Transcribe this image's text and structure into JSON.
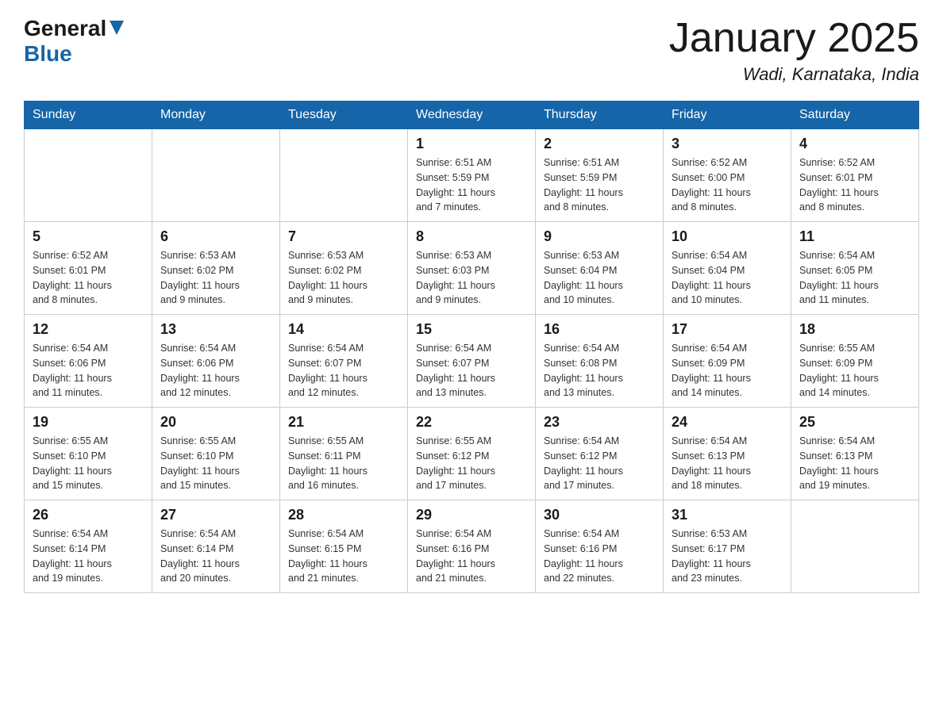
{
  "header": {
    "logo_general": "General",
    "logo_blue": "Blue",
    "month_title": "January 2025",
    "location": "Wadi, Karnataka, India"
  },
  "weekdays": [
    "Sunday",
    "Monday",
    "Tuesday",
    "Wednesday",
    "Thursday",
    "Friday",
    "Saturday"
  ],
  "weeks": [
    [
      {
        "day": "",
        "info": ""
      },
      {
        "day": "",
        "info": ""
      },
      {
        "day": "",
        "info": ""
      },
      {
        "day": "1",
        "info": "Sunrise: 6:51 AM\nSunset: 5:59 PM\nDaylight: 11 hours\nand 7 minutes."
      },
      {
        "day": "2",
        "info": "Sunrise: 6:51 AM\nSunset: 5:59 PM\nDaylight: 11 hours\nand 8 minutes."
      },
      {
        "day": "3",
        "info": "Sunrise: 6:52 AM\nSunset: 6:00 PM\nDaylight: 11 hours\nand 8 minutes."
      },
      {
        "day": "4",
        "info": "Sunrise: 6:52 AM\nSunset: 6:01 PM\nDaylight: 11 hours\nand 8 minutes."
      }
    ],
    [
      {
        "day": "5",
        "info": "Sunrise: 6:52 AM\nSunset: 6:01 PM\nDaylight: 11 hours\nand 8 minutes."
      },
      {
        "day": "6",
        "info": "Sunrise: 6:53 AM\nSunset: 6:02 PM\nDaylight: 11 hours\nand 9 minutes."
      },
      {
        "day": "7",
        "info": "Sunrise: 6:53 AM\nSunset: 6:02 PM\nDaylight: 11 hours\nand 9 minutes."
      },
      {
        "day": "8",
        "info": "Sunrise: 6:53 AM\nSunset: 6:03 PM\nDaylight: 11 hours\nand 9 minutes."
      },
      {
        "day": "9",
        "info": "Sunrise: 6:53 AM\nSunset: 6:04 PM\nDaylight: 11 hours\nand 10 minutes."
      },
      {
        "day": "10",
        "info": "Sunrise: 6:54 AM\nSunset: 6:04 PM\nDaylight: 11 hours\nand 10 minutes."
      },
      {
        "day": "11",
        "info": "Sunrise: 6:54 AM\nSunset: 6:05 PM\nDaylight: 11 hours\nand 11 minutes."
      }
    ],
    [
      {
        "day": "12",
        "info": "Sunrise: 6:54 AM\nSunset: 6:06 PM\nDaylight: 11 hours\nand 11 minutes."
      },
      {
        "day": "13",
        "info": "Sunrise: 6:54 AM\nSunset: 6:06 PM\nDaylight: 11 hours\nand 12 minutes."
      },
      {
        "day": "14",
        "info": "Sunrise: 6:54 AM\nSunset: 6:07 PM\nDaylight: 11 hours\nand 12 minutes."
      },
      {
        "day": "15",
        "info": "Sunrise: 6:54 AM\nSunset: 6:07 PM\nDaylight: 11 hours\nand 13 minutes."
      },
      {
        "day": "16",
        "info": "Sunrise: 6:54 AM\nSunset: 6:08 PM\nDaylight: 11 hours\nand 13 minutes."
      },
      {
        "day": "17",
        "info": "Sunrise: 6:54 AM\nSunset: 6:09 PM\nDaylight: 11 hours\nand 14 minutes."
      },
      {
        "day": "18",
        "info": "Sunrise: 6:55 AM\nSunset: 6:09 PM\nDaylight: 11 hours\nand 14 minutes."
      }
    ],
    [
      {
        "day": "19",
        "info": "Sunrise: 6:55 AM\nSunset: 6:10 PM\nDaylight: 11 hours\nand 15 minutes."
      },
      {
        "day": "20",
        "info": "Sunrise: 6:55 AM\nSunset: 6:10 PM\nDaylight: 11 hours\nand 15 minutes."
      },
      {
        "day": "21",
        "info": "Sunrise: 6:55 AM\nSunset: 6:11 PM\nDaylight: 11 hours\nand 16 minutes."
      },
      {
        "day": "22",
        "info": "Sunrise: 6:55 AM\nSunset: 6:12 PM\nDaylight: 11 hours\nand 17 minutes."
      },
      {
        "day": "23",
        "info": "Sunrise: 6:54 AM\nSunset: 6:12 PM\nDaylight: 11 hours\nand 17 minutes."
      },
      {
        "day": "24",
        "info": "Sunrise: 6:54 AM\nSunset: 6:13 PM\nDaylight: 11 hours\nand 18 minutes."
      },
      {
        "day": "25",
        "info": "Sunrise: 6:54 AM\nSunset: 6:13 PM\nDaylight: 11 hours\nand 19 minutes."
      }
    ],
    [
      {
        "day": "26",
        "info": "Sunrise: 6:54 AM\nSunset: 6:14 PM\nDaylight: 11 hours\nand 19 minutes."
      },
      {
        "day": "27",
        "info": "Sunrise: 6:54 AM\nSunset: 6:14 PM\nDaylight: 11 hours\nand 20 minutes."
      },
      {
        "day": "28",
        "info": "Sunrise: 6:54 AM\nSunset: 6:15 PM\nDaylight: 11 hours\nand 21 minutes."
      },
      {
        "day": "29",
        "info": "Sunrise: 6:54 AM\nSunset: 6:16 PM\nDaylight: 11 hours\nand 21 minutes."
      },
      {
        "day": "30",
        "info": "Sunrise: 6:54 AM\nSunset: 6:16 PM\nDaylight: 11 hours\nand 22 minutes."
      },
      {
        "day": "31",
        "info": "Sunrise: 6:53 AM\nSunset: 6:17 PM\nDaylight: 11 hours\nand 23 minutes."
      },
      {
        "day": "",
        "info": ""
      }
    ]
  ]
}
